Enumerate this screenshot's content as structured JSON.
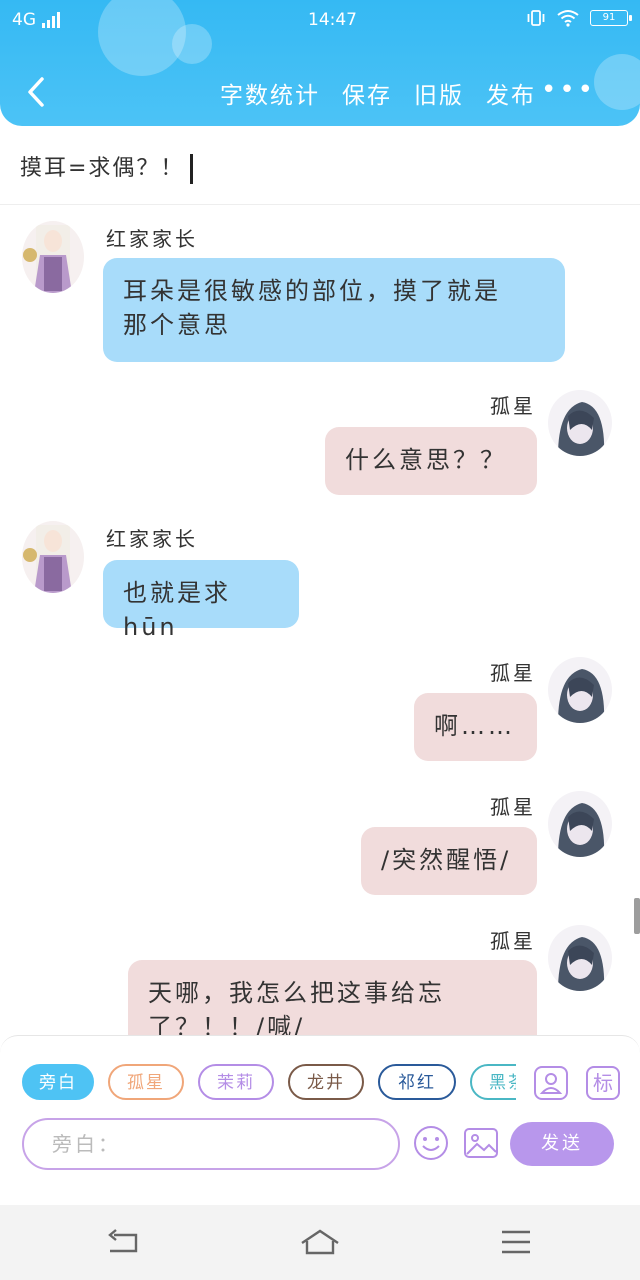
{
  "status": {
    "network": "4G",
    "time": "14:47",
    "battery": "91"
  },
  "toolbar": {
    "word_count": "字数统计",
    "save": "保存",
    "old_version": "旧版",
    "publish": "发布",
    "more": "•••"
  },
  "title": "摸耳=求偶？！",
  "messages": [
    {
      "side": "left",
      "name": "红家家长",
      "text_lines": [
        "耳朵是很敏感的部位，摸了就是",
        "那个意思"
      ]
    },
    {
      "side": "right",
      "name": "孤星",
      "text_lines": [
        "什么意思？？"
      ]
    },
    {
      "side": "left",
      "name": "红家家长",
      "text_lines": [
        "也就是求hūn"
      ]
    },
    {
      "side": "right",
      "name": "孤星",
      "text_lines": [
        "啊……"
      ]
    },
    {
      "side": "right",
      "name": "孤星",
      "text_lines": [
        "/突然醒悟/"
      ]
    },
    {
      "side": "right",
      "name": "孤星",
      "text_lines": [
        "天哪，我怎么把这事给忘",
        "了？！！/喊/"
      ]
    }
  ],
  "role_chips": [
    {
      "label": "旁白",
      "color": "#4ec3f4",
      "selected": true
    },
    {
      "label": "孤星",
      "color": "#f0a679",
      "selected": false
    },
    {
      "label": "茉莉",
      "color": "#b48de6",
      "selected": false
    },
    {
      "label": "龙井",
      "color": "#7a5a48",
      "selected": false
    },
    {
      "label": "祁红",
      "color": "#2a5a9a",
      "selected": false
    },
    {
      "label": "黑茶",
      "color": "#4ab7c4",
      "selected": false
    }
  ],
  "side_buttons": {
    "character": "character-icon",
    "tag": "标"
  },
  "input": {
    "placeholder": "旁白："
  },
  "send_label": "发送",
  "colors": {
    "header": "#35b9f3",
    "left_bubble": "#a8dcfa",
    "right_bubble": "#f1dcdc",
    "accent": "#b897ec"
  }
}
